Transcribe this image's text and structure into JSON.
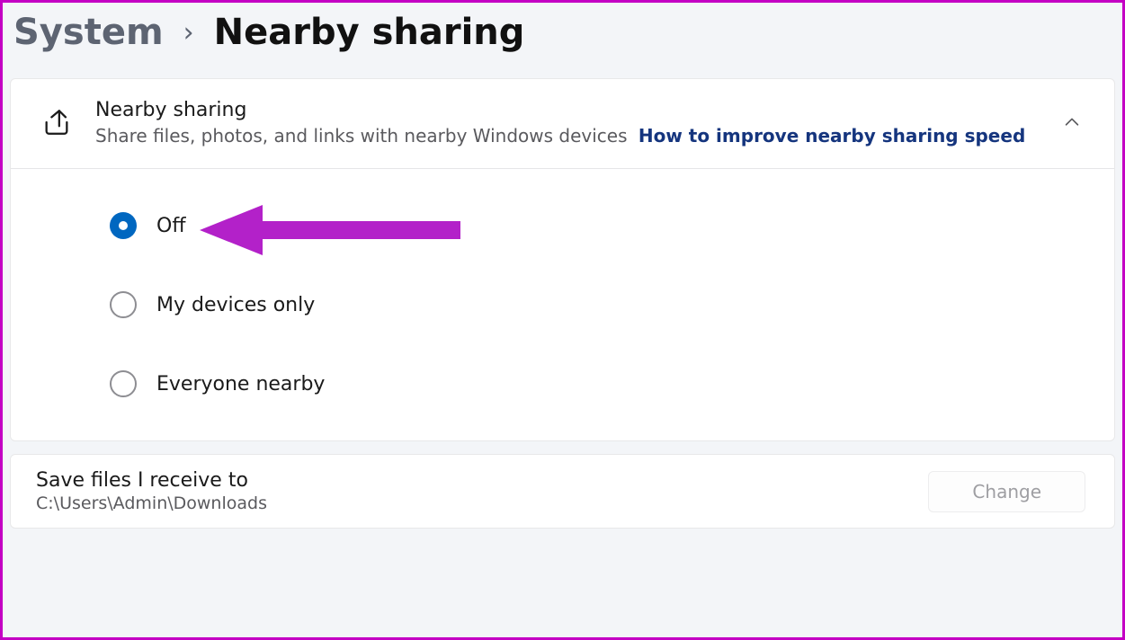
{
  "breadcrumb": {
    "parent": "System",
    "separator": "›",
    "current": "Nearby sharing"
  },
  "panel": {
    "title": "Nearby sharing",
    "subtitle": "Share files, photos, and links with nearby Windows devices",
    "link": "How to improve nearby sharing speed"
  },
  "radios": {
    "opt0": "Off",
    "opt1": "My devices only",
    "opt2": "Everyone nearby"
  },
  "footer": {
    "title": "Save files I receive to",
    "path": "C:\\Users\\Admin\\Downloads",
    "button": "Change"
  }
}
